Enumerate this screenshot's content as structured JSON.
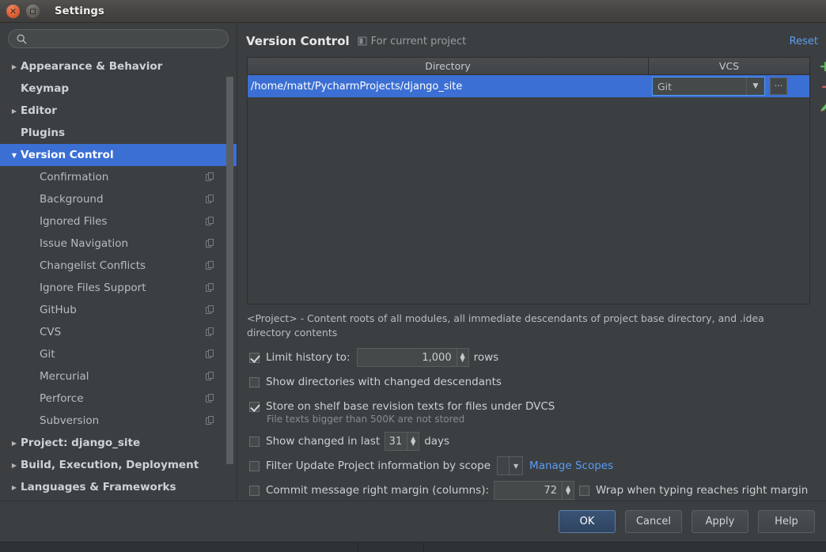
{
  "window": {
    "title": "Settings",
    "close_icon": "close-icon",
    "maximize_icon": "maximize-icon"
  },
  "sidebar": {
    "search": {
      "value": "",
      "placeholder": "",
      "icon": "search-icon"
    },
    "items": [
      {
        "label": "Appearance & Behavior",
        "level": "top",
        "arrow": "▶",
        "selected": false,
        "badge": false
      },
      {
        "label": "Keymap",
        "level": "top",
        "arrow": "",
        "selected": false,
        "badge": false
      },
      {
        "label": "Editor",
        "level": "top",
        "arrow": "▶",
        "selected": false,
        "badge": false
      },
      {
        "label": "Plugins",
        "level": "top",
        "arrow": "",
        "selected": false,
        "badge": false
      },
      {
        "label": "Version Control",
        "level": "top",
        "arrow": "▼",
        "selected": true,
        "badge": false
      },
      {
        "label": "Confirmation",
        "level": "child",
        "arrow": "",
        "selected": false,
        "badge": true
      },
      {
        "label": "Background",
        "level": "child",
        "arrow": "",
        "selected": false,
        "badge": true
      },
      {
        "label": "Ignored Files",
        "level": "child",
        "arrow": "",
        "selected": false,
        "badge": true
      },
      {
        "label": "Issue Navigation",
        "level": "child",
        "arrow": "",
        "selected": false,
        "badge": true
      },
      {
        "label": "Changelist Conflicts",
        "level": "child",
        "arrow": "",
        "selected": false,
        "badge": true
      },
      {
        "label": "Ignore Files Support",
        "level": "child",
        "arrow": "",
        "selected": false,
        "badge": true
      },
      {
        "label": "GitHub",
        "level": "child",
        "arrow": "",
        "selected": false,
        "badge": true
      },
      {
        "label": "CVS",
        "level": "child",
        "arrow": "",
        "selected": false,
        "badge": true
      },
      {
        "label": "Git",
        "level": "child",
        "arrow": "",
        "selected": false,
        "badge": true
      },
      {
        "label": "Mercurial",
        "level": "child",
        "arrow": "",
        "selected": false,
        "badge": true
      },
      {
        "label": "Perforce",
        "level": "child",
        "arrow": "",
        "selected": false,
        "badge": true
      },
      {
        "label": "Subversion",
        "level": "child",
        "arrow": "",
        "selected": false,
        "badge": true
      },
      {
        "label": "Project: django_site",
        "level": "top",
        "arrow": "▶",
        "selected": false,
        "badge": false
      },
      {
        "label": "Build, Execution, Deployment",
        "level": "top",
        "arrow": "▶",
        "selected": false,
        "badge": false
      },
      {
        "label": "Languages & Frameworks",
        "level": "top",
        "arrow": "▶",
        "selected": false,
        "badge": false
      }
    ]
  },
  "page": {
    "title": "Version Control",
    "scope_note": "For current project",
    "scope_icon": "project-scope-icon",
    "reset_label": "Reset"
  },
  "table": {
    "columns": [
      "Directory",
      "VCS"
    ],
    "rows": [
      {
        "directory": "/home/matt/PycharmProjects/django_site",
        "vcs": "Git",
        "selected": true
      }
    ],
    "vcs_dropdown_arrow": "▼",
    "browse_label": "···"
  },
  "toolbar": {
    "add_label": "+",
    "remove_label": "–",
    "edit_icon": "pencil-icon"
  },
  "description": "<Project> - Content roots of all modules, all immediate descendants of project base directory, and .idea directory contents",
  "options": {
    "limit_history": {
      "label": "Limit history to:",
      "checked": true,
      "value": "1,000",
      "suffix": "rows"
    },
    "show_dirs_changed": {
      "label": "Show directories with changed descendants",
      "checked": false
    },
    "store_on_shelf": {
      "label": "Store on shelf base revision texts for files under DVCS",
      "checked": true,
      "hint": "File texts bigger than 500K are not stored"
    },
    "show_changed_last": {
      "label": "Show changed in last",
      "checked": false,
      "value": "31",
      "suffix": "days"
    },
    "filter_by_scope": {
      "label": "Filter Update Project information by scope",
      "checked": false,
      "scope_value": "",
      "manage_link": "Manage Scopes"
    },
    "commit_margin": {
      "label": "Commit message right margin (columns):",
      "checked": false,
      "value": "72",
      "wrap_label": "Wrap when typing reaches right margin",
      "wrap_checked": false
    }
  },
  "buttons": {
    "ok": "OK",
    "cancel": "Cancel",
    "apply": "Apply",
    "help": "Help"
  },
  "colors": {
    "accent": "#3b6fd4",
    "link": "#589df6",
    "add": "#62b562",
    "remove": "#d35f5a",
    "panel": "#3c3f41"
  }
}
